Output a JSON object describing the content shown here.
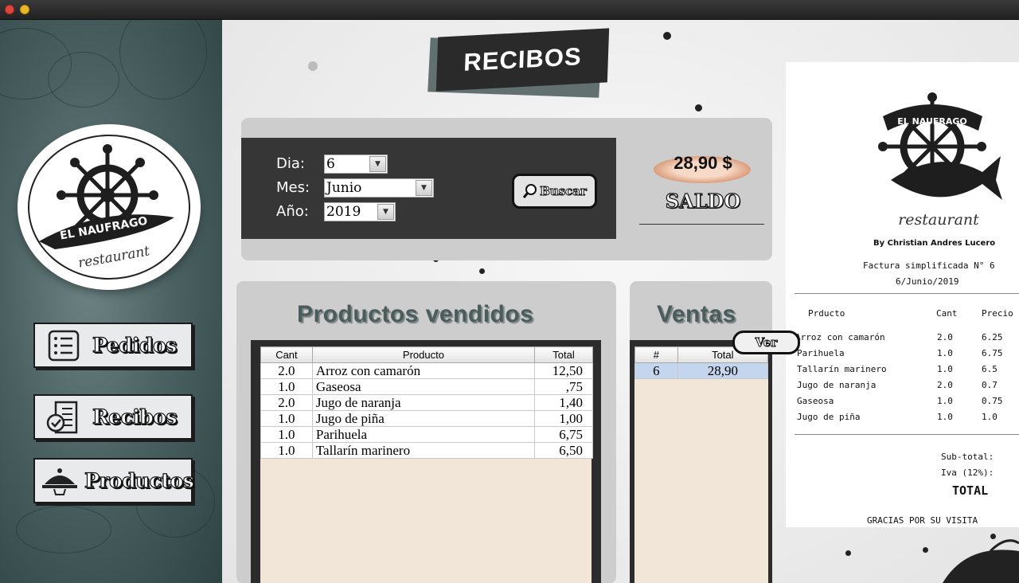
{
  "window": {
    "controls": [
      "close",
      "minimize"
    ]
  },
  "sidebar": {
    "logo": {
      "line1": "EL NAUFRAGO",
      "line2": "restaurant"
    },
    "items": [
      {
        "label": "Pedidos",
        "icon": "list-icon"
      },
      {
        "label": "Recibos",
        "icon": "receipt-icon"
      },
      {
        "label": "Productos",
        "icon": "cloche-icon"
      }
    ]
  },
  "header": {
    "title": "RECIBOS"
  },
  "filters": {
    "dia_label": "Dia:",
    "dia_value": "6",
    "mes_label": "Mes:",
    "mes_value": "Junio",
    "anio_label": "Año:",
    "anio_value": "2019",
    "buscar_label": "Buscar"
  },
  "saldo": {
    "value": "28,90 $",
    "label": "SALDO"
  },
  "productos": {
    "title": "Productos vendidos",
    "columns": [
      "Cant",
      "Producto",
      "Total"
    ],
    "rows": [
      {
        "cant": "2.0",
        "producto": "Arroz con camarón",
        "total": "12,50"
      },
      {
        "cant": "1.0",
        "producto": "Gaseosa",
        "total": ",75"
      },
      {
        "cant": "2.0",
        "producto": "Jugo de naranja",
        "total": "1,40"
      },
      {
        "cant": "1.0",
        "producto": "Jugo de piña",
        "total": "1,00"
      },
      {
        "cant": "1.0",
        "producto": "Parihuela",
        "total": "6,75"
      },
      {
        "cant": "1.0",
        "producto": "Tallarín marinero",
        "total": "6,50"
      }
    ]
  },
  "ventas": {
    "title": "Ventas",
    "columns": [
      "#",
      "Total"
    ],
    "rows": [
      {
        "num": "6",
        "total": "28,90"
      }
    ],
    "ver_label": "Ver"
  },
  "receipt": {
    "logo": {
      "line1": "EL NAUFRAGO",
      "line2": "restaurant"
    },
    "author": "By Christian Andres Lucero",
    "invoice": "Factura simplificada N° 6",
    "date": "6/Junio/2019",
    "columns": [
      "Prducto",
      "Cant",
      "Precio"
    ],
    "items": [
      {
        "producto": "Arroz con camarón",
        "cant": "2.0",
        "precio": "6.25"
      },
      {
        "producto": "Parihuela",
        "cant": "1.0",
        "precio": "6.75"
      },
      {
        "producto": "Tallarín marinero",
        "cant": "1.0",
        "precio": "6.5"
      },
      {
        "producto": "Jugo de naranja",
        "cant": "2.0",
        "precio": "0.7"
      },
      {
        "producto": "Gaseosa",
        "cant": "1.0",
        "precio": "0.75"
      },
      {
        "producto": "Jugo de piña",
        "cant": "1.0",
        "precio": "1.0"
      }
    ],
    "subtotal_label": "Sub-total:",
    "iva_label": "Iva (12%):",
    "total_label": "TOTAL",
    "footer": "GRACIAS POR SU VISITA"
  }
}
